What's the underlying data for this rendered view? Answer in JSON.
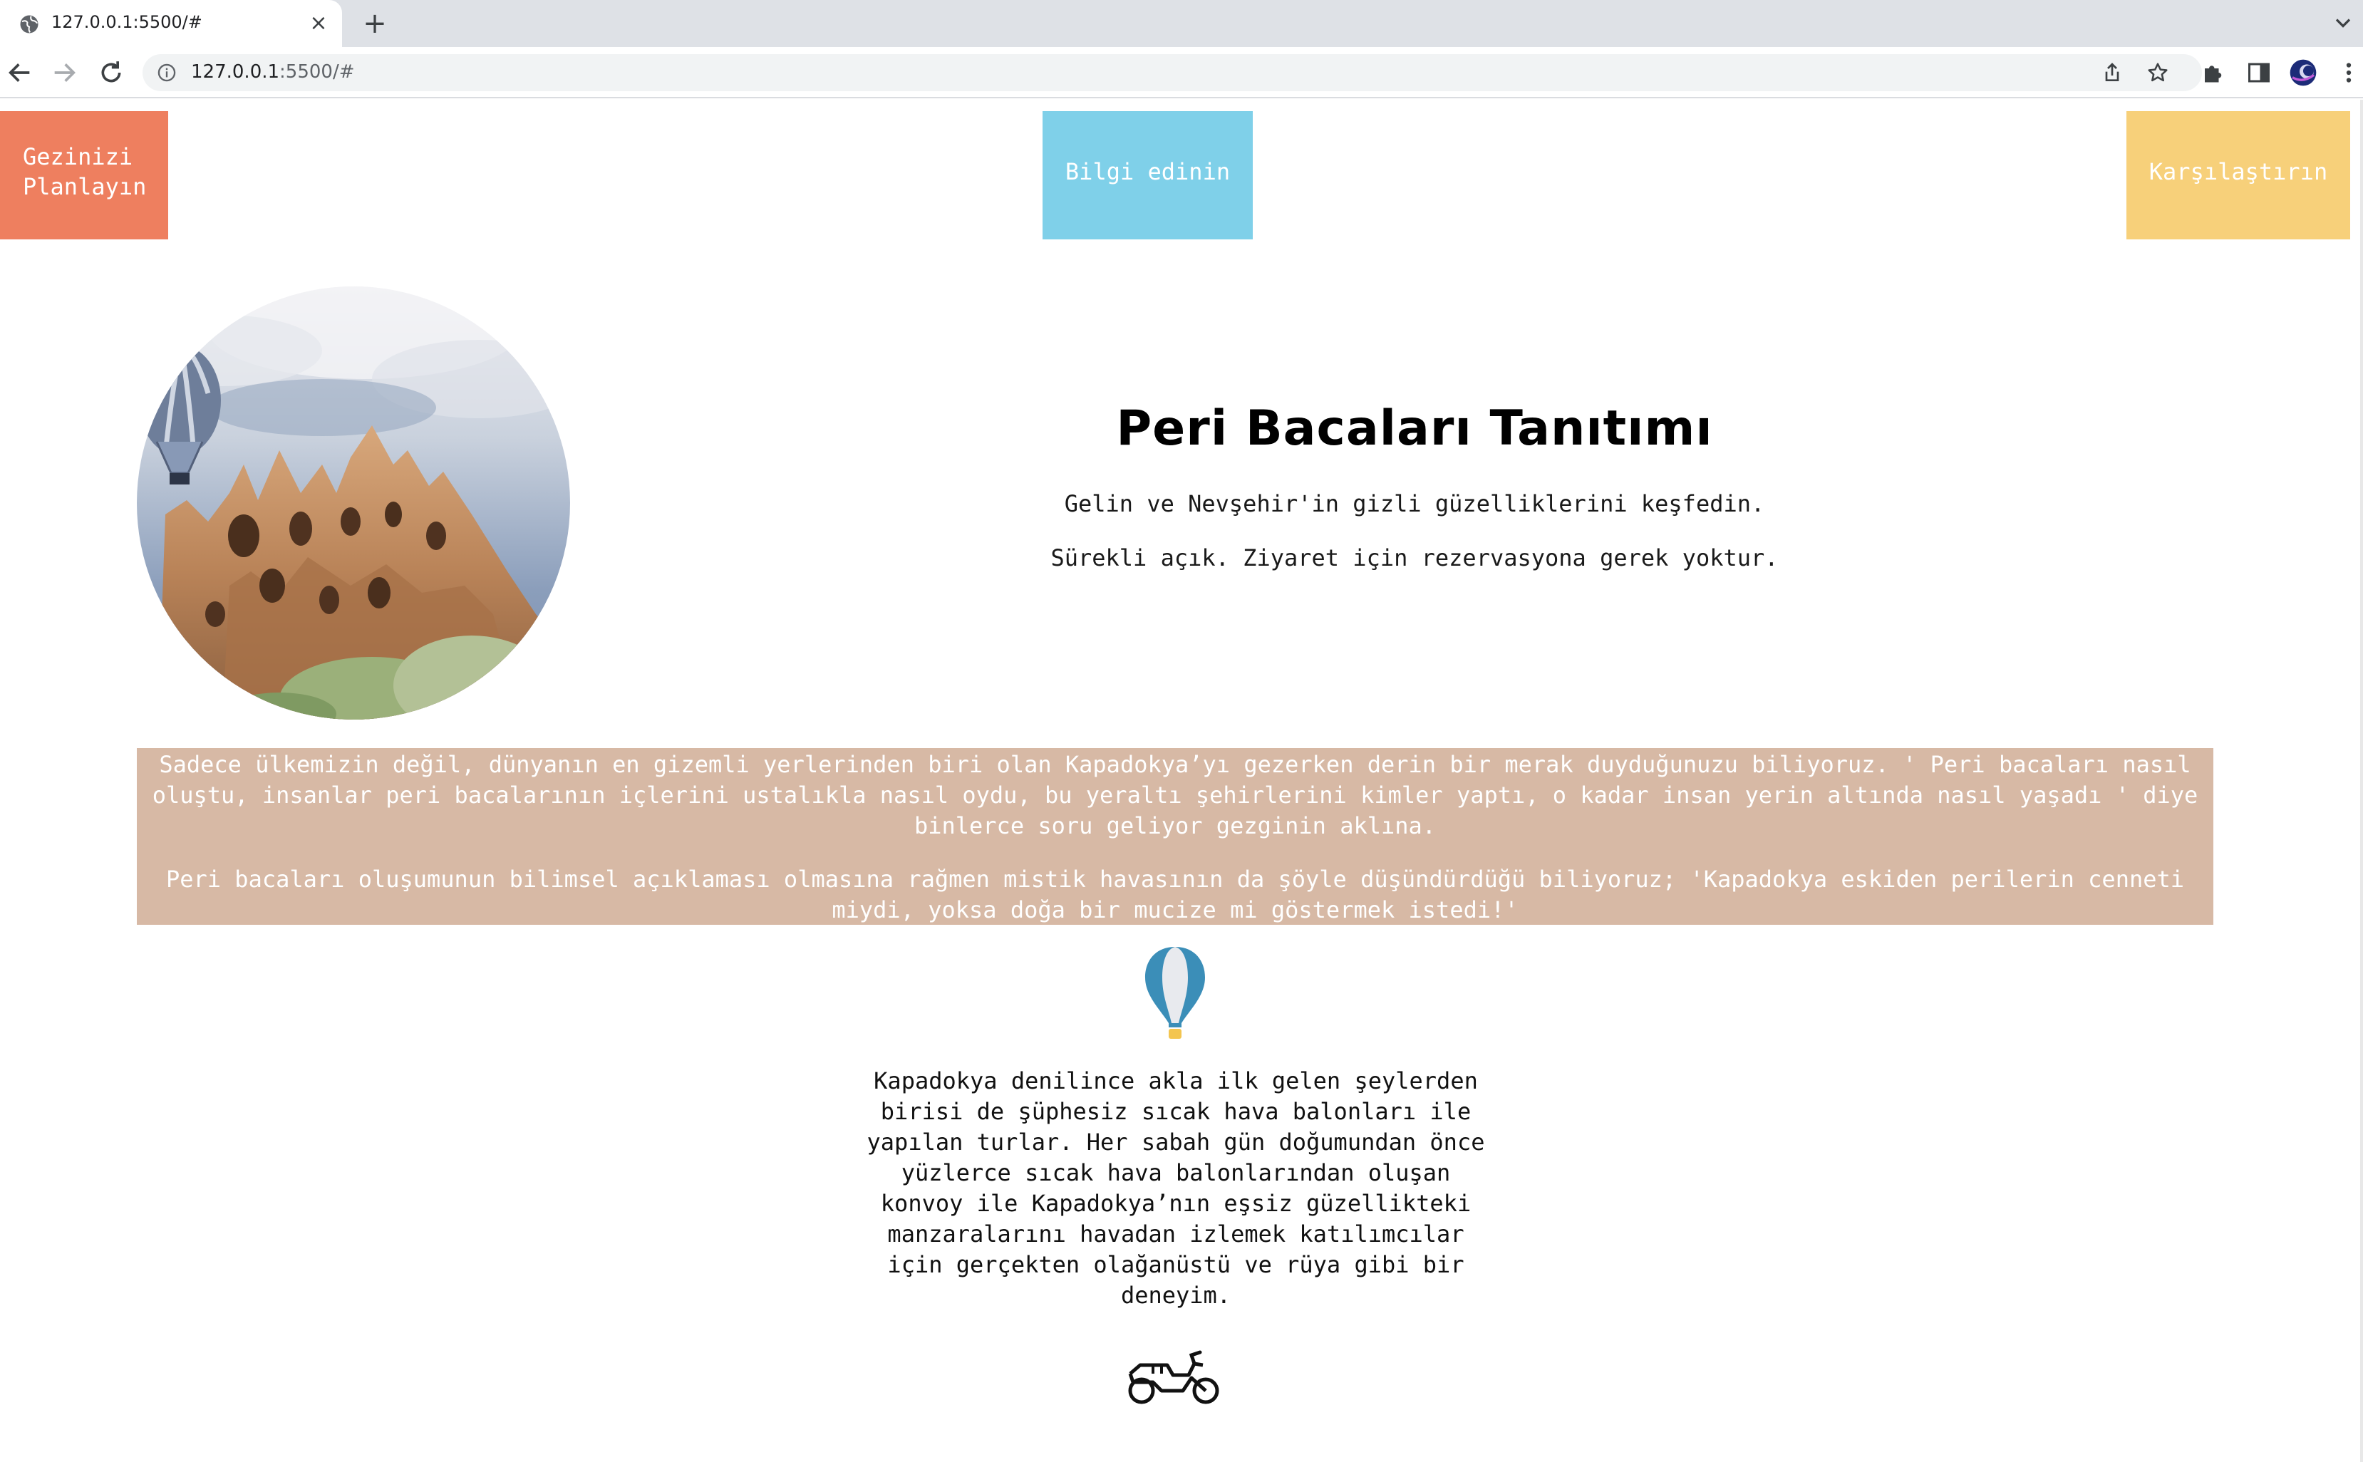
{
  "browser": {
    "tab_title": "127.0.0.1:5500/#",
    "url_host": "127.0.0.1",
    "url_rest": ":5500/#",
    "icons": [
      "globe-icon",
      "close-icon",
      "plus-icon",
      "chevron-down-icon",
      "back-arrow-icon",
      "forward-arrow-icon",
      "reload-icon",
      "info-icon",
      "share-icon",
      "star-icon",
      "puzzle-icon",
      "side-panel-icon",
      "profile-avatar-icon",
      "more-vert-icon"
    ]
  },
  "nav": {
    "plan_line1": "Gezinizi",
    "plan_line2": "Planlayın",
    "info": "Bilgi edinin",
    "compare": "Karşılaştırın",
    "colors": {
      "plan": "#ee7f5f",
      "info": "#7fd0e9",
      "compare": "#f7d07a"
    }
  },
  "hero": {
    "title": "Peri Bacaları Tanıtımı",
    "subtitle_1": "Gelin ve Nevşehir'in gizli güzelliklerini keşfedin.",
    "subtitle_2": "Sürekli açık. Ziyaret için rezervasyona gerek yoktur."
  },
  "info_block": {
    "bg_color": "#d7b9a5",
    "paragraph_1": "Sadece ülkemizin değil, dünyanın en gizemli yerlerinden biri olan Kapadokya’yı gezerken derin bir merak duyduğunuzu biliyoruz. ' Peri bacaları nasıl oluştu, insanlar peri bacalarının içlerini ustalıkla nasıl oydu, bu yeraltı şehirlerini kimler yaptı, o kadar insan yerin altında nasıl yaşadı ' diye binlerce soru geliyor gezginin aklına.",
    "paragraph_2": "Peri bacaları oluşumunun bilimsel açıklaması olmasına rağmen mistik havasının da şöyle düşündürdüğü biliyoruz; 'Kapadokya eskiden perilerin cenneti miydi, yoksa doğa bir mucize mi göstermek istedi!'"
  },
  "balloon_section": {
    "icon": "hot-air-balloon-icon",
    "text": "Kapadokya denilince akla ilk gelen şeylerden birisi de şüphesiz sıcak hava balonları ile yapılan turlar. Her sabah gün doğumundan önce yüzlerce sıcak hava balonlarından oluşan konvoy ile Kapadokya’nın eşsiz güzellikteki manzaralarını havadan izlemek katılımcılar için gerçekten olağanüstü ve rüya gibi bir deneyim."
  },
  "moto_section": {
    "icon": "motorcycle-icon"
  }
}
